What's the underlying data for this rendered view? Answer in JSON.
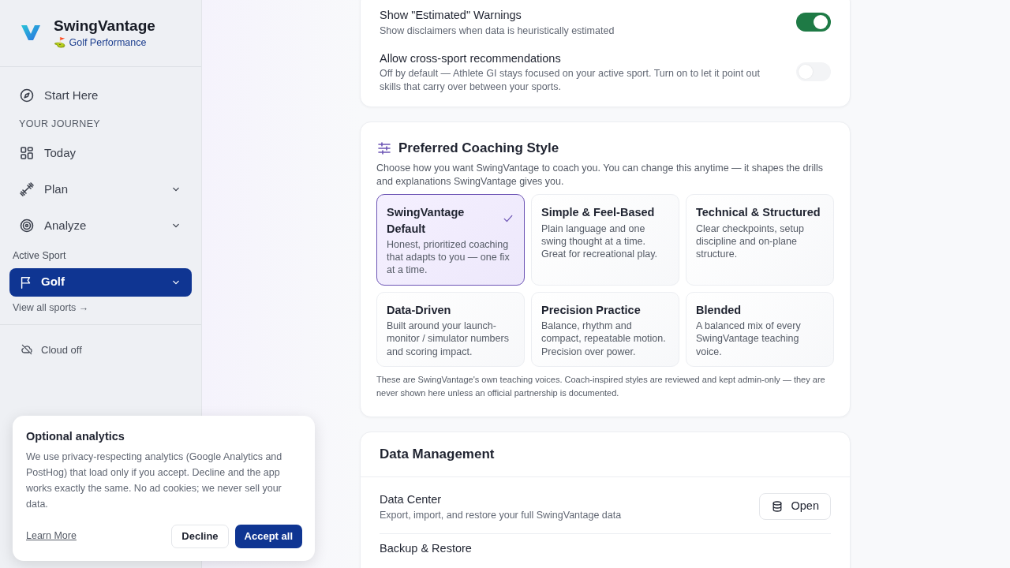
{
  "brand": {
    "name": "SwingVantage",
    "subtitle": "⛳ Golf Performance"
  },
  "sidebar": {
    "start_item": {
      "label": "Start Here"
    },
    "section_label": "YOUR JOURNEY",
    "items": [
      {
        "label": "Today",
        "expandable": false
      },
      {
        "label": "Plan",
        "expandable": true
      },
      {
        "label": "Analyze",
        "expandable": true
      }
    ],
    "active_sport": {
      "label": "Active Sport",
      "value": "Golf",
      "link": "View all sports →"
    },
    "footer_items": [
      {
        "label": "Cloud off"
      }
    ]
  },
  "preferences": {
    "toggles": [
      {
        "title": "Show \"Estimated\" Warnings",
        "description": "Show disclaimers when data is heuristically estimated",
        "on": true
      },
      {
        "title": "Allow cross-sport recommendations",
        "description": "Off by default — Athlete GI stays focused on your active sport. Turn on to let it point out skills that carry over between your sports.",
        "on": false
      }
    ]
  },
  "coaching_style": {
    "title": "Preferred Coaching Style",
    "description": "Choose how you want SwingVantage to coach you. You can change this anytime — it shapes the drills and explanations SwingVantage gives you.",
    "options": [
      {
        "title": "SwingVantage Default",
        "description": "Honest, prioritized coaching that adapts to you — one fix at a time.",
        "selected": true
      },
      {
        "title": "Simple & Feel-Based",
        "description": "Plain language and one swing thought at a time. Great for recreational play.",
        "selected": false
      },
      {
        "title": "Technical & Structured",
        "description": "Clear checkpoints, setup discipline and on-plane structure.",
        "selected": false
      },
      {
        "title": "Data-Driven",
        "description": "Built around your launch-monitor / simulator numbers and scoring impact.",
        "selected": false
      },
      {
        "title": "Precision Practice",
        "description": "Balance, rhythm and compact, repeatable motion. Precision over power.",
        "selected": false
      },
      {
        "title": "Blended",
        "description": "A balanced mix of every SwingVantage teaching voice.",
        "selected": false
      }
    ],
    "footnote": "These are SwingVantage's own teaching voices. Coach-inspired styles are reviewed and kept admin-only — they are never shown here unless an official partnership is documented."
  },
  "data_management": {
    "title": "Data Management",
    "rows": [
      {
        "title": "Data Center",
        "description": "Export, import, and restore your full SwingVantage data",
        "button": "Open"
      },
      {
        "title": "Backup & Restore"
      }
    ]
  },
  "cookie_banner": {
    "title": "Optional analytics",
    "text": "We use privacy-respecting analytics (Google Analytics and PostHog) that load only if you accept. Decline and the app works exactly the same. No ad cookies; we never sell your data.",
    "link": "Learn More",
    "buttons": [
      {
        "label": "Decline",
        "kind": "secondary"
      },
      {
        "label": "Accept all",
        "kind": "primary"
      }
    ]
  }
}
